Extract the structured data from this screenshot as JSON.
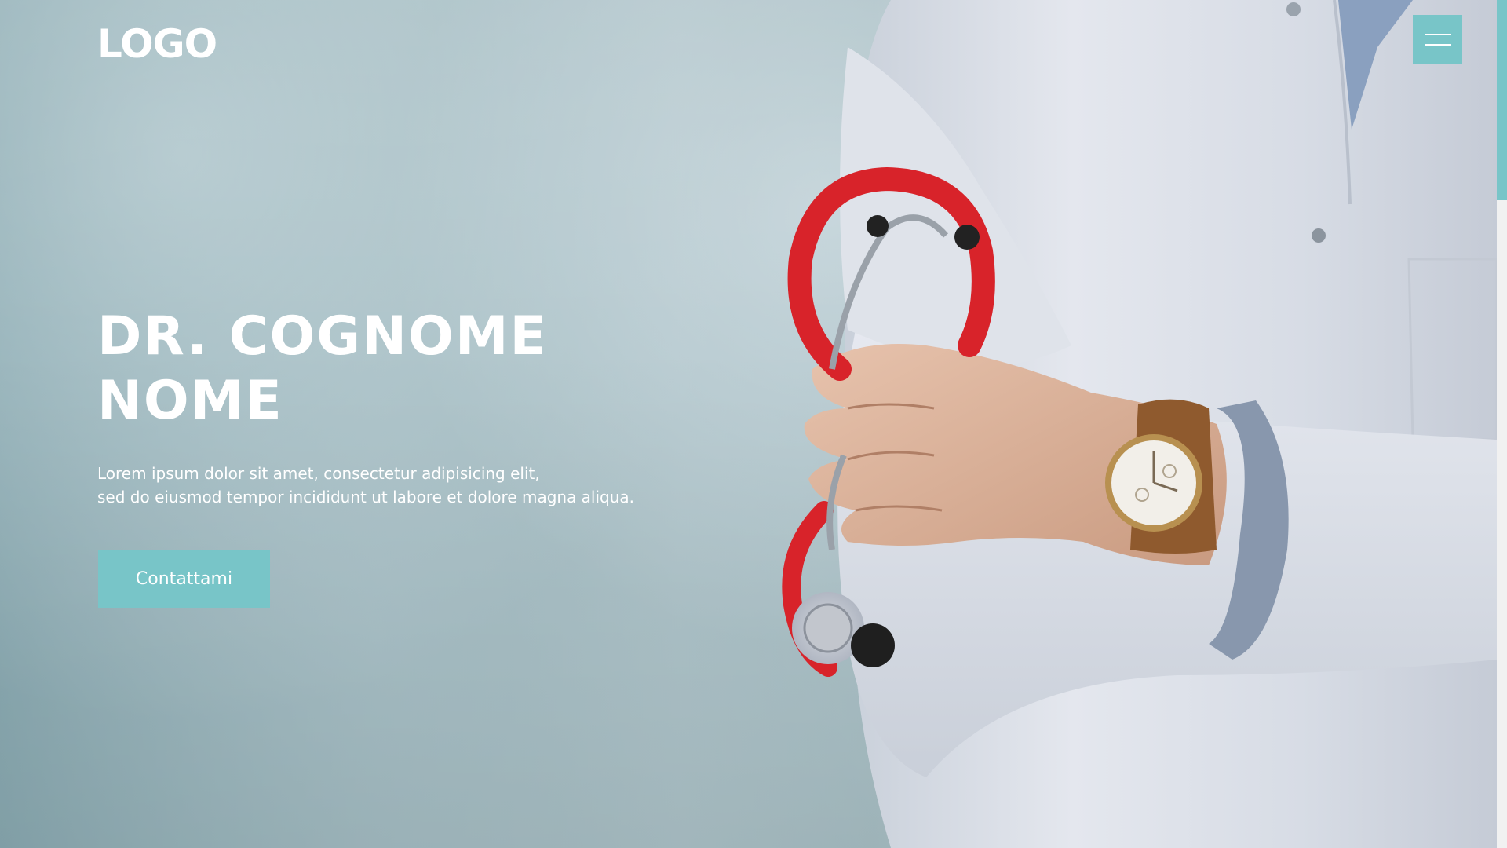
{
  "header": {
    "logo_text": "LOGO",
    "menu_icon": "hamburger-menu-icon"
  },
  "hero": {
    "title_line1": "DR. COGNOME",
    "title_line2": "NOME",
    "description_line1": "Lorem ipsum dolor sit amet, consectetur adipisicing elit,",
    "description_line2": "sed do eiusmod tempor incididunt ut labore et dolore magna aliqua.",
    "cta_label": "Contattami"
  },
  "colors": {
    "accent": "#78c5c8",
    "text": "#ffffff",
    "stethoscope": "#d8232a",
    "coat": "#e6e8ee"
  }
}
